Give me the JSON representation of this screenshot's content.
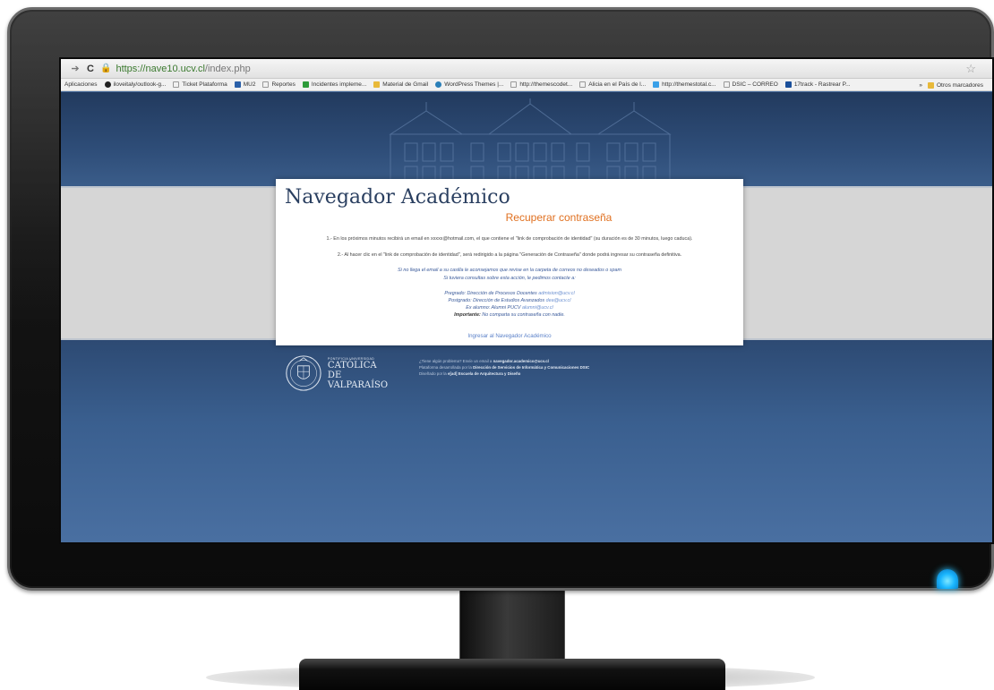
{
  "browser": {
    "url_host": "https://nave10.ucv.cl",
    "url_path": "/index.php",
    "bookmarks": [
      {
        "label": "Aplicaciones",
        "color": "#5a8ad6"
      },
      {
        "label": "iloveitaly/outlook-g...",
        "color": "#222222"
      },
      {
        "label": "Ticket Plataforma",
        "color": "#cccccc"
      },
      {
        "label": "MU2",
        "color": "#2a5fa8"
      },
      {
        "label": "Reportes",
        "color": "#cccccc"
      },
      {
        "label": "Incidentes impleme...",
        "color": "#2e9b3a"
      },
      {
        "label": "Material de Gmail",
        "color": "#e8b93a"
      },
      {
        "label": "WordPress Themes |...",
        "color": "#2a7fb8"
      },
      {
        "label": "http://themescodet...",
        "color": "#cccccc"
      },
      {
        "label": "Alicia en el País de l...",
        "color": "#cccccc"
      },
      {
        "label": "http://themestotal.c...",
        "color": "#3aa0e8"
      },
      {
        "label": "DSIC – CORREO",
        "color": "#cccccc"
      },
      {
        "label": "17track - Rastrear P...",
        "color": "#1a4f9a"
      }
    ],
    "other_bookmarks": "Otros marcadores",
    "overflow": "»"
  },
  "page": {
    "brand_title": "Navegador Académico",
    "heading": "Recuperar contraseña",
    "step1": "1.- En los próximos minutos recibirá un email en xxxxx@hotmail.com, el que contiene el \"link de comprobación de identidad\" (su duración es de 30 minutos, luego caduca).",
    "step2": "2.- Al hacer clic en el \"link de comprobación de identidad\", será redirigido a la página \"Generación de Contraseña\" donde podrá ingresar su contraseña definitiva.",
    "spam_note": "Si no llega el email a su casilla le aconsejamos que revise en la carpeta de correos no deseados o spam",
    "contact_note": "Si tuviera consultas sobre esta acción, le pedimos contacte a:",
    "pregrado_label": "Pregrado: Dirección de Procesos Docentes",
    "pregrado_email": "admision@ucv.cl",
    "postgrado_label": "Postgrado: Dirección de Estudios Avanzados",
    "postgrado_email": "dea@ucv.cl",
    "exalumno_label": "Ex alumno: Alumni PUCV",
    "exalumno_email": "alumni@ucv.cl",
    "important_label": "Importante:",
    "important_text": "No comparta su contraseña con nadie.",
    "enter_link": "Ingresar al Navegador Académico"
  },
  "footer": {
    "uni_small": "PONTIFICIA UNIVERSIDAD",
    "uni_line1": "CATÓLICA",
    "uni_line2": "DE VALPARAÍSO",
    "help_prefix": "¿Tiene algún problema? Envíe un email a",
    "help_email": "navegador.academico@ucv.cl",
    "dev_prefix": "Plataforma desarrollada por la",
    "dev_org": "Dirección de Servicios de Informática y Comunicaciones DSIC",
    "design_prefix": "Diseñado por la",
    "design_org": "e[ad] Escuela de Arquitectura y Diseño"
  },
  "colors": {
    "accent_orange": "#e07020",
    "power_led": "#19b6ff"
  }
}
